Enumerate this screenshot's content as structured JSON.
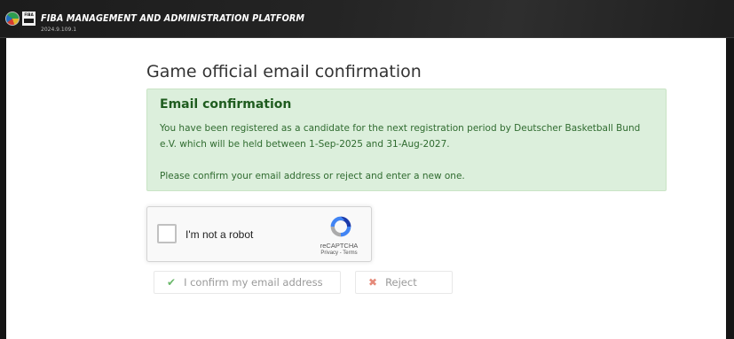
{
  "app": {
    "title": "FIBA MANAGEMENT AND ADMINISTRATION PLATFORM",
    "version": "2024.9.109.1",
    "logo_text": "FIBA"
  },
  "page": {
    "title": "Game official email confirmation"
  },
  "alert": {
    "heading": "Email confirmation",
    "message": "You have been registered as a candidate for the next registration period by Deutscher Basketball Bund e.V. which will be held between 1-Sep-2025 and 31-Aug-2027.",
    "instruction": "Please confirm your email address or reject and enter a new one.",
    "background_color": "#dcefdc"
  },
  "recaptcha": {
    "label": "I'm not a robot",
    "brand": "reCAPTCHA",
    "privacy_link": "Privacy",
    "separator": " - ",
    "terms_link": "Terms",
    "checked": false
  },
  "actions": {
    "confirm_label": "I confirm my email address",
    "confirm_icon": "check-icon",
    "reject_label": "Reject",
    "reject_icon": "x-icon"
  }
}
